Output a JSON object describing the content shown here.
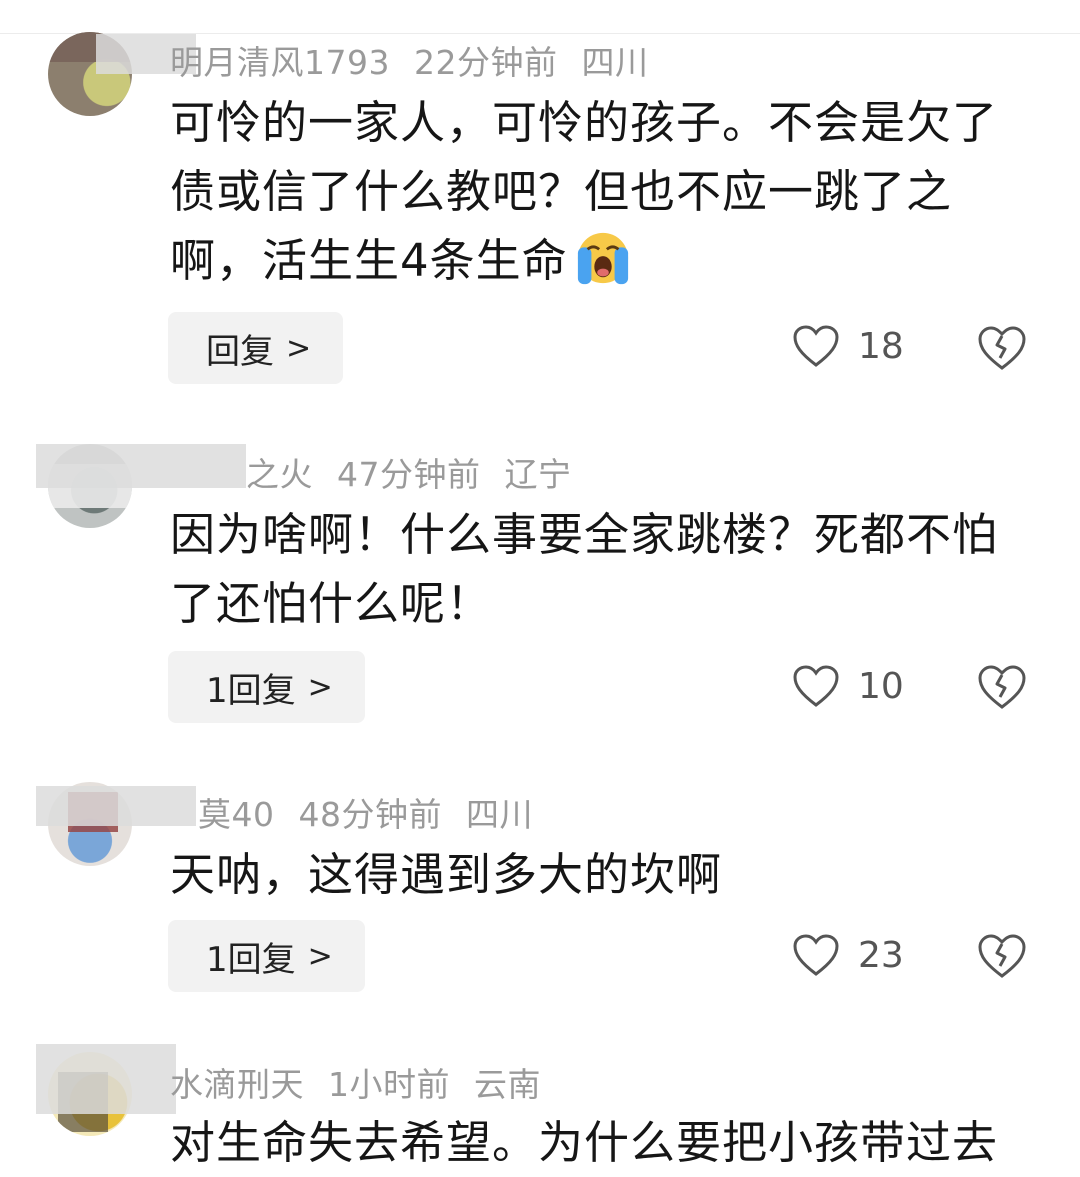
{
  "comments": [
    {
      "username": "明月清风1793",
      "time": "22分钟前",
      "location": "四川",
      "text": "可怜的一家人，可怜的孩子。不会是欠了债或信了什么教吧？但也不应一跳了之啊，活生生4条生命",
      "emoji": "loudly-crying-face",
      "reply_label": "回复",
      "likes": "18"
    },
    {
      "username": "之火",
      "time": "47分钟前",
      "location": "辽宁",
      "text": "因为啥啊！什么事要全家跳楼？死都不怕了还怕什么呢！",
      "reply_label": "1回复",
      "likes": "10"
    },
    {
      "username": "莫40",
      "time": "48分钟前",
      "location": "四川",
      "text": "天呐，这得遇到多大的坎啊",
      "reply_label": "1回复",
      "likes": "23"
    },
    {
      "username": "水滴刑天",
      "time": "1小时前",
      "location": "云南",
      "text": "对生命失去希望。为什么要把小孩带过去"
    }
  ],
  "colors": {
    "text": "#161616",
    "meta": "#9a9a9a",
    "reply_bg": "#f2f2f2",
    "icon": "#555555"
  }
}
